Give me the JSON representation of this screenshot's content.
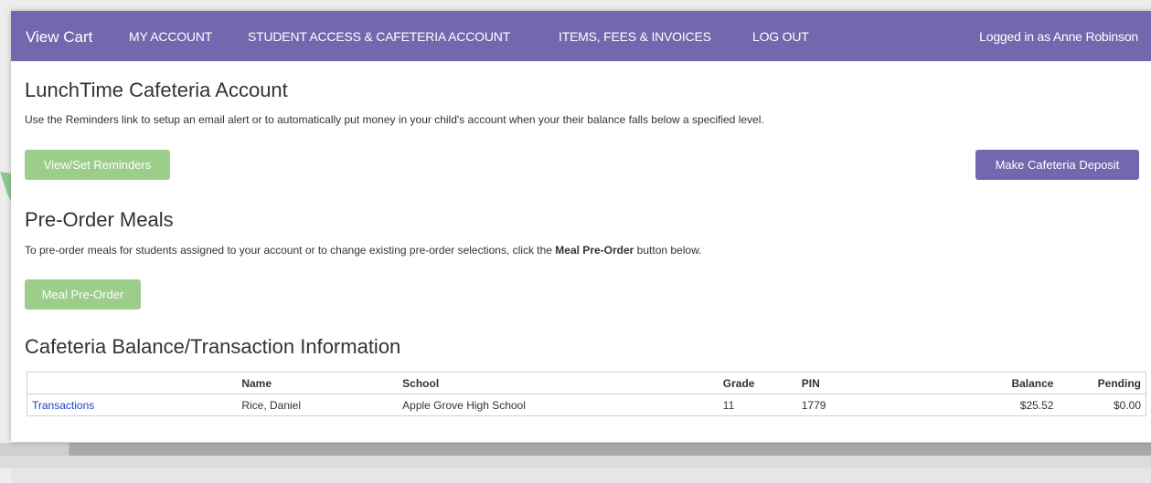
{
  "navbar": {
    "brand": "View Cart",
    "items": [
      "MY ACCOUNT",
      "STUDENT ACCESS & CAFETERIA ACCOUNT",
      "ITEMS, FEES & INVOICES",
      "LOG OUT"
    ],
    "user": "Logged in as Anne Robinson"
  },
  "cafeteria": {
    "title": "LunchTime Cafeteria Account",
    "description": "Use the Reminders link to setup an email alert or to automatically put money in your child's account when your their balance falls below a specified level.",
    "reminders_button": "View/Set Reminders",
    "deposit_button": "Make Cafeteria Deposit"
  },
  "preorder": {
    "title": "Pre-Order Meals",
    "description_before": "To pre-order meals for students assigned to your account or to change existing pre-order selections, click the ",
    "description_bold": "Meal Pre-Order",
    "description_after": " button below.",
    "button": "Meal Pre-Order"
  },
  "balance": {
    "title": "Cafeteria Balance/Transaction Information",
    "columns": [
      "",
      "Name",
      "School",
      "Grade",
      "PIN",
      "Balance",
      "Pending"
    ],
    "rows": [
      {
        "link": "Transactions",
        "name": "Rice, Daniel",
        "school": "Apple Grove High School",
        "grade": "11",
        "pin": "1779",
        "balance": "$25.52",
        "pending": "$0.00"
      }
    ]
  },
  "colors": {
    "nav": "#7168ad",
    "green_button": "#9ccd8a",
    "purple_button": "#7168ad",
    "link": "#1f3ec9"
  }
}
